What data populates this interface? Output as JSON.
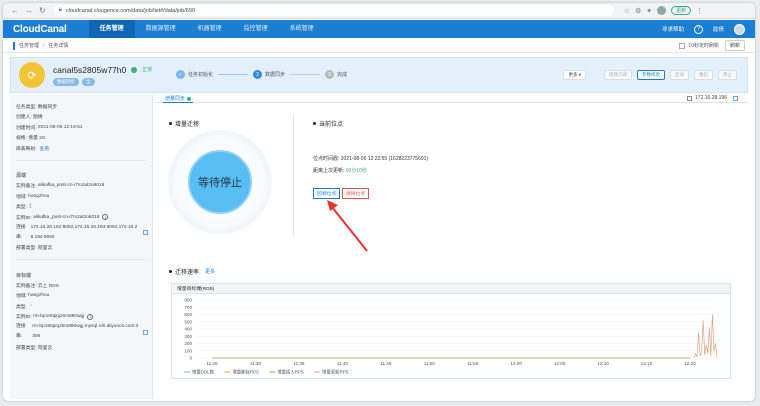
{
  "browser": {
    "url": "cloudcanal.clougence.com/data/job/list#/data/job/690",
    "update_label": "更新"
  },
  "app": {
    "logo": "CloudCanal",
    "nav": [
      {
        "label": "任务管理",
        "active": true
      },
      {
        "label": "数据源管理",
        "active": false
      },
      {
        "label": "机器管理",
        "active": false
      },
      {
        "label": "监控管理",
        "active": false
      },
      {
        "label": "系统管理",
        "active": false
      }
    ],
    "help_label": "寻求帮助",
    "help_icon": "?",
    "username": "励倩"
  },
  "breadcrumb": {
    "items": [
      "任务管理",
      "任务详情"
    ],
    "refresh_label": "10秒定时刷新",
    "refresh_button": "刷新"
  },
  "job": {
    "name": "canal5s2805w77h0",
    "status": "正常",
    "tags": [
      "数据同步",
      "全"
    ],
    "steps": [
      {
        "num": "✓",
        "label": "任务初始化",
        "state": "done"
      },
      {
        "num": "2",
        "label": "数据同步",
        "state": "cur"
      },
      {
        "num": "3",
        "label": "完成",
        "state": "todo"
      }
    ],
    "more_button": "更多",
    "actions": [
      "修改订阅",
      "参数修改",
      "启动",
      "重启",
      "停止"
    ]
  },
  "left": {
    "meta": [
      {
        "label": "任务类型:",
        "value": "数据同步"
      },
      {
        "label": "创建人:",
        "value": "励倩"
      },
      {
        "label": "创建时间:",
        "value": "2021-08-06 12:19:51"
      },
      {
        "label": "规格:",
        "value": "增量 2G"
      },
      {
        "label": "库表映射:",
        "value": "查看",
        "link": true
      }
    ],
    "source": {
      "title": "源端",
      "note_label": "实例备注:",
      "note": "alikafka_post-cn-i7m2al2o6018",
      "region_label": "地域:",
      "region": "hangzhou",
      "type_label": "类型:",
      "id_label": "实例ID:",
      "id": "alikafka_post-cn-i7m2al2o6018",
      "conn_label": "连接串:",
      "conn": "172.16.28.192:9092,172.16.28.193:9092,172.16.28.194:9092",
      "deploy_label": "部署类型:",
      "deploy": "阿里云"
    },
    "target": {
      "title": "目标端",
      "note_label": "实例备注:",
      "note": "云上 RDS",
      "region_label": "地域:",
      "region": "hangzhou",
      "type_label": "类型:",
      "id_label": "实例ID:",
      "id": "rm-bp190pnjz6m880wgj",
      "conn_label": "连接串:",
      "conn": "rm-bp190pnjz6m880wgj.mysql.rds.aliyuncs.com:3306",
      "deploy_label": "部署类型:",
      "deploy": "阿里云"
    }
  },
  "main": {
    "tab": "增量同步",
    "ip": "172.16.28.196",
    "migration_title": "增量迁移",
    "state_text": "等待停止",
    "position_title": "当前位点",
    "position_time_label": "位点时间戳:",
    "position_time": "2021-08-06 12:22:55  (1628223775691)",
    "last_update_label": "距离上次更新:",
    "last_update": "00分10秒",
    "reset_button": "回溯位点",
    "clear_button": "清除位点",
    "rate_title": "迁移速率",
    "rate_more": "更多",
    "chart_head": "增量目标端(RDB)"
  },
  "colors": {
    "brand": "#1a7fd2",
    "status_green": "#3cb371",
    "state_blue": "#58bdf3",
    "arrow_red": "#e8352a"
  },
  "chart_data": {
    "type": "line",
    "title": "增量目标端(RDB)",
    "x": [
      "11:25",
      "11:30",
      "11:35",
      "11:40",
      "11:45",
      "11:50",
      "11:55",
      "12:00",
      "12:05",
      "12:10",
      "12:15",
      "12:20"
    ],
    "ylim": [
      0,
      800
    ],
    "yticks": [
      0,
      100,
      200,
      300,
      400,
      500,
      600,
      700,
      800
    ],
    "legend_position": "bottom-left",
    "series": [
      {
        "name": "增量DDL数",
        "color": "#a0a0a0",
        "values": [
          0,
          0,
          0,
          0,
          0,
          0,
          0,
          0,
          0,
          0,
          0,
          0
        ]
      },
      {
        "name": "增量删除RPS",
        "color": "#e6a23c",
        "values": [
          0,
          0,
          0,
          0,
          0,
          0,
          0,
          0,
          0,
          0,
          0,
          0
        ]
      },
      {
        "name": "增量插入RPS",
        "color": "#67c23a",
        "values": [
          0,
          0,
          0,
          0,
          0,
          0,
          0,
          0,
          0,
          0,
          0,
          0
        ]
      },
      {
        "name": "增量更新RPS",
        "color": "#d9a58a",
        "values": [
          0,
          0,
          0,
          0,
          0,
          0,
          0,
          0,
          0,
          0,
          0,
          0
        ]
      }
    ],
    "spike_series": {
      "name": "增量更新RPS",
      "x_range": [
        "12:20",
        "12:23"
      ],
      "values": [
        0,
        60,
        20,
        350,
        30,
        80,
        520,
        40,
        180,
        60,
        420,
        20,
        600,
        90,
        200,
        0
      ]
    }
  }
}
